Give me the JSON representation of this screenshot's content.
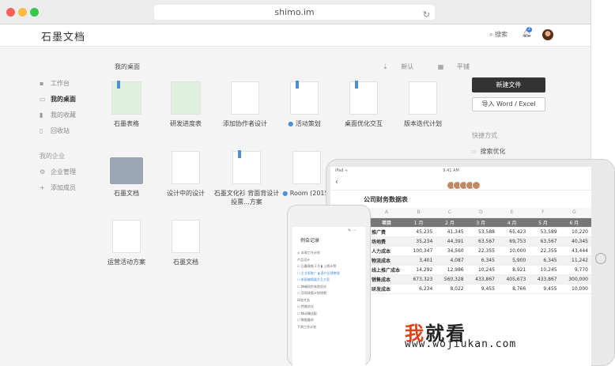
{
  "browser": {
    "url": "shimo.im",
    "dot_colors": [
      "#fc605c",
      "#fdbc40",
      "#34c84a"
    ]
  },
  "app": {
    "logo": "石墨文档",
    "search_label": "搜索",
    "notif_count": "2"
  },
  "sidebar": {
    "items": [
      {
        "icon": "▪",
        "label": "工作台"
      },
      {
        "icon": "▭",
        "label": "我的桌面"
      },
      {
        "icon": "▮",
        "label": "我的收藏"
      },
      {
        "icon": "▯",
        "label": "回收站"
      }
    ],
    "group_label": "我的企业",
    "enterprise_items": [
      {
        "icon": "⚙",
        "label": "企业管理"
      },
      {
        "icon": "+",
        "label": "添加成员"
      }
    ]
  },
  "desktop": {
    "title": "我的桌面",
    "tool_new": "新认",
    "tool_grid": "平铺",
    "files": [
      {
        "label": "石墨表格",
        "kind": "sheet"
      },
      {
        "label": "研发进度表",
        "kind": "sheet"
      },
      {
        "label": "添加协作者设计",
        "kind": "doc"
      },
      {
        "label": "活动策划",
        "kind": "doc"
      },
      {
        "label": "桌面优化交互",
        "kind": "doc"
      },
      {
        "label": "版本迭代计划",
        "kind": "doc"
      },
      {
        "label": "石墨文档",
        "kind": "folder"
      },
      {
        "label": "设计中的设计",
        "kind": "doc"
      },
      {
        "label": "石墨文化衫 背面背设计投票...方案",
        "kind": "doc"
      },
      {
        "label": "Room (2015)",
        "kind": "doc"
      },
      {
        "label": "运营活动方案",
        "kind": "doc"
      },
      {
        "label": "石墨文档",
        "kind": "doc"
      }
    ]
  },
  "actions": {
    "new_file": "新建文件",
    "import": "导入 Word / Excel"
  },
  "quick": {
    "title": "快捷方式",
    "item": "搜索优化"
  },
  "tablet": {
    "status_left": "iPad ≈",
    "status_mid": "9:41 AM",
    "back": "‹",
    "sheet_title": "公司财务数据表",
    "letters": [
      "A",
      "B",
      "C",
      "D",
      "E",
      "F",
      "G"
    ],
    "header": [
      "项目",
      "1 月",
      "2 月",
      "3 月",
      "4 月",
      "5 月",
      "6 月"
    ],
    "rows": [
      [
        "推广费",
        "45,235",
        "41,345",
        "53,588",
        "65,423",
        "53,589",
        "10,220"
      ],
      [
        "场地费",
        "35,234",
        "44,391",
        "63,567",
        "69,753",
        "63,567",
        "40,345"
      ],
      [
        "人力成本",
        "100,347",
        "34,560",
        "22,355",
        "10,000",
        "22,355",
        "43,444"
      ],
      [
        "物流成本",
        "3,401",
        "4,087",
        "6,345",
        "5,900",
        "6,345",
        "11,242"
      ],
      [
        "线上推广成本",
        "14,292",
        "12,986",
        "10,245",
        "8,921",
        "10,245",
        "9,770"
      ],
      [
        "销售成本",
        "673,323",
        "560,328",
        "433,867",
        "405,673",
        "433,867",
        "300,000"
      ],
      [
        "研发成本",
        "6,234",
        "8,022",
        "9,455",
        "8,766",
        "9,455",
        "10,000"
      ]
    ]
  },
  "phone": {
    "title": "例会记录",
    "lines": [
      "◎ 本周工作计划",
      "产品设计",
      "☐ 石墨表格 2.0 ▮ 上线计划",
      "☐ 企业版推广 ▮ 客户反馈整理",
      "☐ 新版编辑器交互方案",
      "☐ 跨端同步体验优化",
      "☐ 官网改版计划排期",
      "研发任务",
      "☐ 性能优化",
      "☐ 移动端适配",
      "☐ 数据备份",
      "下周工作计划"
    ]
  },
  "watermark": {
    "first_char": "我",
    "rest": "就看",
    "url": "www.wojiukan.com"
  }
}
